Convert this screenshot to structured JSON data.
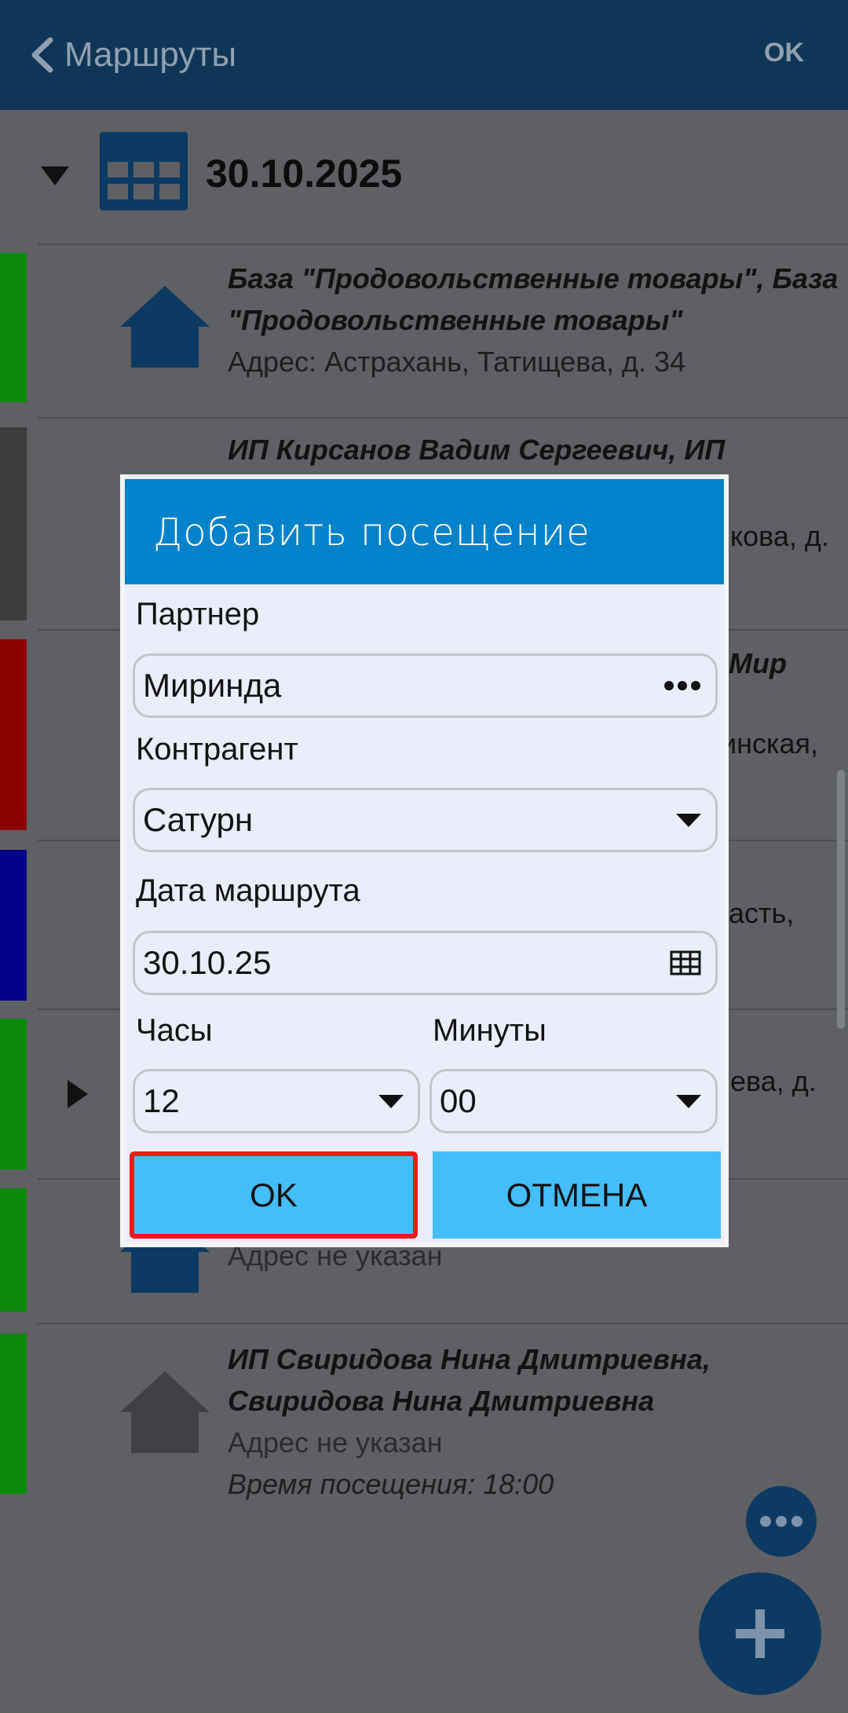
{
  "header": {
    "back_label": "Маршруты",
    "ok_label": "OK"
  },
  "date_row": {
    "date": "30.10.2025"
  },
  "items": [
    {
      "title": "База \"Продовольственные товары\", База \"Продовольственные товары\"",
      "address": "Адрес: Астрахань, Татищева, д. 34",
      "stripe_color": "#0c8a0c"
    },
    {
      "title": "ИП Кирсанов Вадим Сергеевич, ИП",
      "stripe_color": "#3d3d3d"
    },
    {
      "title": "ИП Свиридова Нина Дмитриевна, Свиридова Нина Дмитриевна",
      "address": "Адрес не указан",
      "visit_time": "Время посещения: 18:00",
      "stripe_color": "#0c8a0c"
    }
  ],
  "background_fragments": {
    "f1": "кова, д.",
    "f2": "Мир",
    "f3": "инская,",
    "f4": "асть,",
    "f5": "ева, д.",
    "f6": "Адрес не указан"
  },
  "dialog": {
    "title": "Добавить посещение",
    "partner_label": "Партнер",
    "partner_value": "Миринда",
    "contractor_label": "Контрагент",
    "contractor_value": "Сатурн",
    "date_label": "Дата маршрута",
    "date_value": "30.10.25",
    "hours_label": "Часы",
    "hours_value": "12",
    "minutes_label": "Минуты",
    "minutes_value": "00",
    "ok_label": "OK",
    "cancel_label": "ОТМЕНА"
  },
  "colors": {
    "header_bg": "#0f3656",
    "dialog_header": "#0282cb",
    "button": "#44bdfb",
    "highlight": "#ee1a1a",
    "stripe_green": "#0c8a0c",
    "stripe_red": "#8b0000",
    "stripe_blue": "#00008b",
    "stripe_gray": "#3d3d3d"
  }
}
